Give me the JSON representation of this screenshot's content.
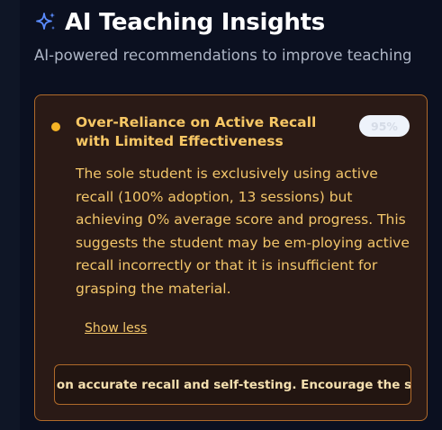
{
  "header": {
    "icon": "sparkle-icon",
    "title": "AI Teaching Insights",
    "subtitle": "AI-powered recommendations to improve teaching"
  },
  "insight": {
    "title": "Over-Reliance on Active Recall with Limited Effectiveness",
    "confidence": "95%",
    "description": "The sole student is exclusively using active recall (100% adoption, 13 sessions) but achieving 0% average score and progress. This suggests the student may be em-ploying active recall incorrectly or that it is insufficient for grasping the material.",
    "toggle_label": "Show less",
    "recommendation": "Provide guidance on accurate recall and self-testing. Encourage the student to",
    "colors": {
      "accent": "#f5b325",
      "border": "#b06a2a",
      "card_bg": "#2a1a16"
    }
  }
}
